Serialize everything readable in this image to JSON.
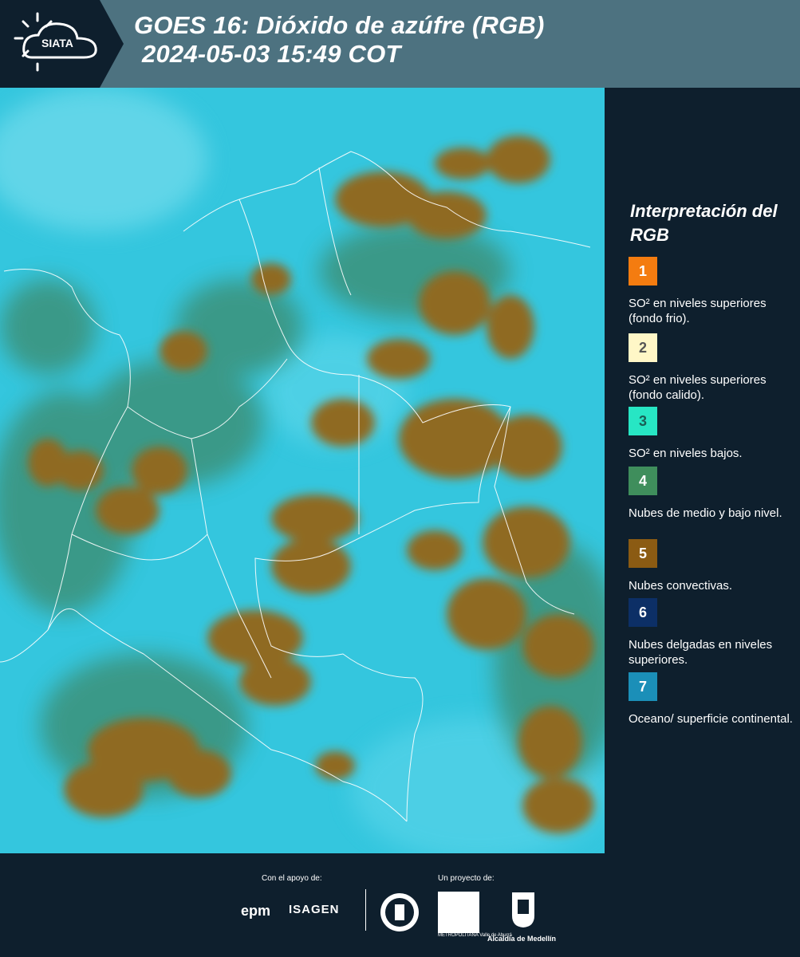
{
  "header": {
    "logo_text": "SIATA",
    "title_line1": "GOES 16: Dióxido de azúfre (RGB)",
    "title_line2": "2024-05-03 15:49 COT"
  },
  "map": {
    "background_color": "#2fc8e0",
    "cloud_color": "#8f6a22",
    "border_color": "#ffffff"
  },
  "legend": {
    "title": "Interpretación del RGB",
    "items": [
      {
        "number": "1",
        "color": "#f47c10",
        "text_color": "#ffffff",
        "label": "SO² en niveles superiores (fondo frio)."
      },
      {
        "number": "2",
        "color": "#fff7c7",
        "text_color": "#555555",
        "label": "SO² en niveles superiores (fondo calido)."
      },
      {
        "number": "3",
        "color": "#27e6c4",
        "text_color": "#1a5e55",
        "label": "SO² en niveles bajos."
      },
      {
        "number": "4",
        "color": "#3f8e5c",
        "text_color": "#ffffff",
        "label": "Nubes de medio y bajo nivel."
      },
      {
        "number": "5",
        "color": "#8b5b13",
        "text_color": "#ffffff",
        "label": "Nubes convectivas."
      },
      {
        "number": "6",
        "color": "#0c2f66",
        "text_color": "#ffffff",
        "label": "Nubes delgadas en niveles superiores."
      },
      {
        "number": "7",
        "color": "#1b8fb8",
        "text_color": "#ffffff",
        "label": "Oceano/ superficie continental."
      }
    ]
  },
  "footer": {
    "support_label": "Con el apoyo de:",
    "project_label": "Un proyecto de:",
    "epm": "epm",
    "isagen": "ISAGEN",
    "area_text": "METROPOLITANA Valle de Aburrá",
    "alcaldia": "Alcaldía de Medellín"
  }
}
